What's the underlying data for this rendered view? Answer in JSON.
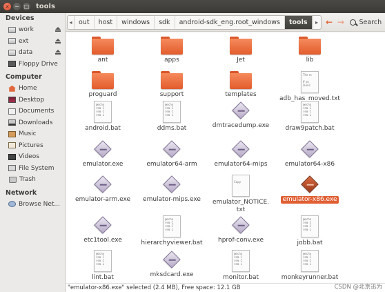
{
  "window": {
    "title": "tools"
  },
  "sidebar": {
    "devices_header": "Devices",
    "devices": [
      {
        "label": "work",
        "icon": "drive-icon",
        "eject": true
      },
      {
        "label": "ext",
        "icon": "drive-icon",
        "eject": true
      },
      {
        "label": "data",
        "icon": "drive-icon",
        "eject": true
      },
      {
        "label": "Floppy Drive",
        "icon": "floppy-icon",
        "eject": false
      }
    ],
    "computer_header": "Computer",
    "computer": [
      {
        "label": "Home",
        "icon": "home-icon"
      },
      {
        "label": "Desktop",
        "icon": "desktop-icon"
      },
      {
        "label": "Documents",
        "icon": "documents-icon"
      },
      {
        "label": "Downloads",
        "icon": "downloads-icon"
      },
      {
        "label": "Music",
        "icon": "music-icon"
      },
      {
        "label": "Pictures",
        "icon": "pictures-icon"
      },
      {
        "label": "Videos",
        "icon": "videos-icon"
      },
      {
        "label": "File System",
        "icon": "filesystem-icon"
      },
      {
        "label": "Trash",
        "icon": "trash-icon"
      }
    ],
    "network_header": "Network",
    "network": [
      {
        "label": "Browse Net...",
        "icon": "network-icon"
      }
    ]
  },
  "toolbar": {
    "breadcrumbs": [
      "out",
      "host",
      "windows",
      "sdk",
      "android-sdk_eng.root_windows",
      "tools"
    ],
    "active_crumb": "tools",
    "search_label": "Search"
  },
  "files": [
    {
      "name": "ant",
      "type": "folder"
    },
    {
      "name": "apps",
      "type": "folder"
    },
    {
      "name": "Jet",
      "type": "folder"
    },
    {
      "name": "lib",
      "type": "folder"
    },
    {
      "name": "proguard",
      "type": "folder"
    },
    {
      "name": "support",
      "type": "folder"
    },
    {
      "name": "templates",
      "type": "folder"
    },
    {
      "name": "adb_has_moved.txt",
      "type": "text"
    },
    {
      "name": "android.bat",
      "type": "bat"
    },
    {
      "name": "ddms.bat",
      "type": "bat"
    },
    {
      "name": "dmtracedump.exe",
      "type": "exe"
    },
    {
      "name": "draw9patch.bat",
      "type": "bat"
    },
    {
      "name": "emulator.exe",
      "type": "exe"
    },
    {
      "name": "emulator64-arm",
      "type": "exe"
    },
    {
      "name": "emulator64-mips",
      "type": "exe"
    },
    {
      "name": "emulator64-x86",
      "type": "exe"
    },
    {
      "name": "emulator-arm.exe",
      "type": "exe"
    },
    {
      "name": "emulator-mips.exe",
      "type": "exe"
    },
    {
      "name": "emulator_NOTICE.\ntxt",
      "type": "text"
    },
    {
      "name": "emulator-x86.exe",
      "type": "exe",
      "selected": true
    },
    {
      "name": "etc1tool.exe",
      "type": "exe"
    },
    {
      "name": "hierarchyviewer.bat",
      "type": "bat"
    },
    {
      "name": "hprof-conv.exe",
      "type": "exe"
    },
    {
      "name": "jobb.bat",
      "type": "bat"
    },
    {
      "name": "lint.bat",
      "type": "bat"
    },
    {
      "name": "mksdcard.exe",
      "type": "exe"
    },
    {
      "name": "monitor.bat",
      "type": "bat"
    },
    {
      "name": "monkeyrunner.bat",
      "type": "bat"
    }
  ],
  "thumbs": {
    "bat": "@echo\nrem C\nrem C\nrem L",
    "text_adb": "The m\n\nIf yo\nlaunc",
    "text_notice": "\nCopy\n\n"
  },
  "status": {
    "text": "\"emulator-x86.exe\" selected (2.4 MB), Free space: 12.1 GB"
  },
  "watermark": "CSDN @北京迅为",
  "colors": {
    "accent": "#e05f33",
    "folder": "#f0774a",
    "titlebar": "#3c3b37"
  }
}
